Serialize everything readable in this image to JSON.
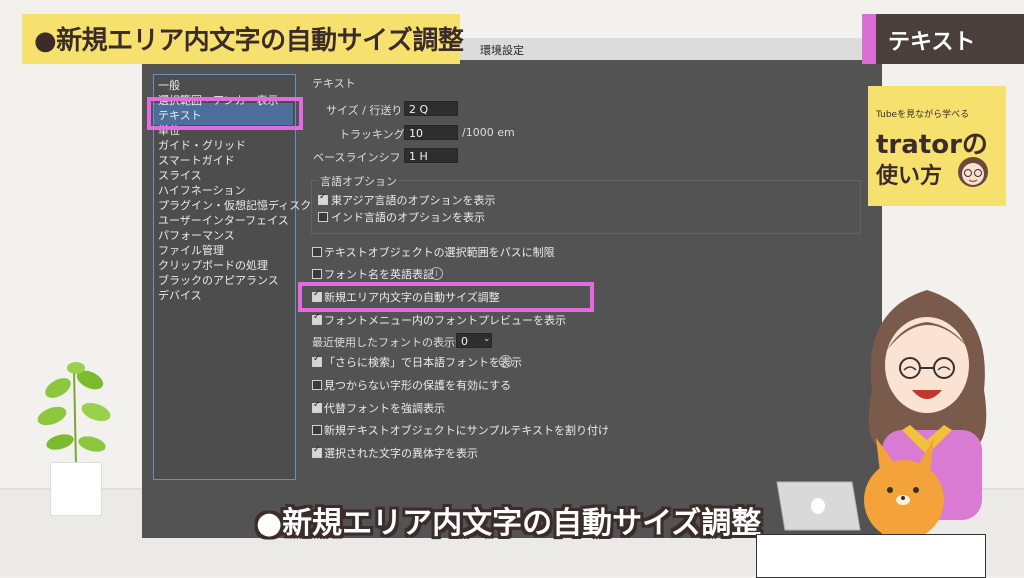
{
  "banner": {
    "title": "●新規エリア内文字の自動サイズ調整"
  },
  "badge": {
    "label": "テキスト"
  },
  "ad": {
    "sub": "Tubeを見ながら学べる",
    "line1": "trator",
    "line1_suffix": "の",
    "line2": "使い方"
  },
  "dialog": {
    "title": "環境設定",
    "categories": [
      "一般",
      "選択範囲・アンカー表示",
      "テキスト",
      "単位",
      "ガイド・グリッド",
      "スマートガイド",
      "スライス",
      "ハイフネーション",
      "プラグイン・仮想記憶ディスク",
      "ユーザーインターフェイス",
      "パフォーマンス",
      "ファイル管理",
      "クリップボードの処理",
      "ブラックのアピアランス",
      "デバイス"
    ],
    "section": "テキスト",
    "size_label": "サイズ / 行送り：",
    "size_value": "2 Q",
    "tracking_label": "トラッキング：",
    "tracking_value": "10",
    "tracking_unit": "/1000 em",
    "baseline_label": "ベースラインシフト：",
    "baseline_value": "1 H",
    "lang_group": "言語オプション",
    "lang_east_asian": "東アジア言語のオプションを表示",
    "lang_indic": "インド言語のオプションを表示",
    "opt_limit_path": "テキストオブジェクトの選択範囲をパスに制限",
    "opt_font_english": "フォント名を英語表記",
    "opt_auto_size": "新規エリア内文字の自動サイズ調整",
    "opt_font_preview": "フォントメニュー内のフォントプレビューを表示",
    "recent_fonts_label": "最近使用したフォントの表示数：",
    "recent_fonts_value": "0",
    "opt_more_search": "「さらに検索」で日本語フォントを表示",
    "opt_missing_glyph": "見つからない字形の保護を有効にする",
    "opt_highlight_sub": "代替フォントを強調表示",
    "opt_sample_text": "新規テキストオブジェクトにサンプルテキストを割り付け",
    "opt_alternates": "選択された文字の異体字を表示",
    "info_icon": "i"
  },
  "subtitle": "●新規エリア内文字の自動サイズ調整",
  "colors": {
    "banner": "#f7e16e",
    "highlight": "#e36be0",
    "dialog": "#535353",
    "selection": "#4b6e9b"
  }
}
